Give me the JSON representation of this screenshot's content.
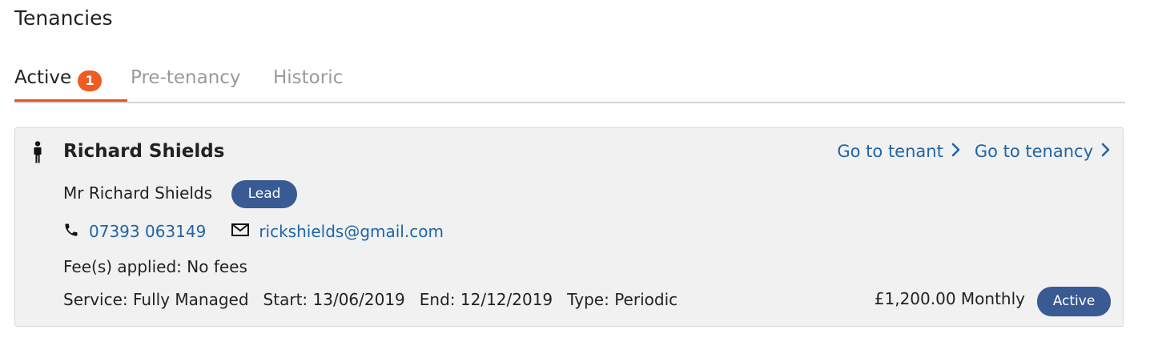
{
  "page": {
    "title": "Tenancies"
  },
  "tabs": [
    {
      "label": "Active",
      "count": "1",
      "active": true
    },
    {
      "label": "Pre-tenancy",
      "active": false
    },
    {
      "label": "Historic",
      "active": false
    }
  ],
  "tenancy": {
    "tenant_name": "Richard Shields",
    "full_name": "Mr Richard Shields",
    "role_badge": "Lead",
    "phone": "07393 063149",
    "email": "rickshields@gmail.com",
    "fees": "Fee(s) applied: No fees",
    "service": "Service: Fully Managed",
    "start": "Start: 13/06/2019",
    "end": "End: 12/12/2019",
    "type": "Type: Periodic",
    "rent": "£1,200.00 Monthly",
    "status": "Active",
    "links": {
      "tenant": "Go to tenant",
      "tenancy": "Go to tenancy"
    }
  },
  "colors": {
    "accent": "#f05a23",
    "link": "#1f65a6",
    "badge": "#3a5a94",
    "card_bg": "#f1f1f1"
  },
  "icons": [
    "person-icon",
    "phone-icon",
    "envelope-icon",
    "chevron-right-icon"
  ]
}
